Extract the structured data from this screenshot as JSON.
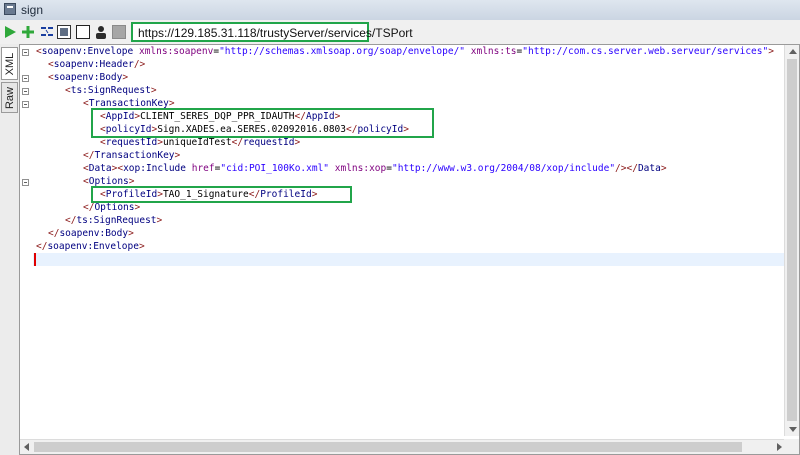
{
  "window": {
    "title": "sign"
  },
  "toolbar": {
    "icons": [
      "run-icon",
      "add-icon",
      "format-icon",
      "window-icon",
      "stop-icon",
      "user-icon",
      "disabled-icon"
    ],
    "url": "https://129.185.31.118/trustyServer/services/TSPort"
  },
  "tabs": {
    "xml_label": "XML",
    "raw_label": "Raw",
    "active": "XML"
  },
  "colors": {
    "highlight": "#21a54a",
    "tag": "#000080",
    "attr": "#7f007f",
    "value": "#2a00ff",
    "brackets": "#8b1a1a"
  },
  "code": {
    "l1": {
      "tag": "soapenv:Envelope",
      "a1": "xmlns:soapenv",
      "v1": "\"http://schemas.xmlsoap.org/soap/envelope/\"",
      "a2": "xmlns:ts",
      "v2": "\"http://com.cs.server.web.serveur/services\""
    },
    "l2": {
      "tag": "soapenv:Header"
    },
    "l3": {
      "tag": "soapenv:Body"
    },
    "l4": {
      "tag": "ts:SignRequest"
    },
    "l5": {
      "tag": "TransactionKey"
    },
    "l6": {
      "tag": "AppId",
      "text": "CLIENT_SERES_DQP_PPR_IDAUTH",
      "close": "AppId"
    },
    "l7": {
      "tag": "policyId",
      "text": "Sign.XADES.ea.SERES.02092016.0803",
      "close": "policyId"
    },
    "l8": {
      "tag": "requestId",
      "text": "uniqueIdTest",
      "close": "requestId"
    },
    "l9": {
      "close": "TransactionKey"
    },
    "l10": {
      "tag": "Data",
      "inner_tag": "xop:Include",
      "a1": "href",
      "v1": "\"cid:POI_100Ko.xml\"",
      "a2": "xmlns:xop",
      "v2": "\"http://www.w3.org/2004/08/xop/include\"",
      "close": "Data"
    },
    "l11": {
      "tag": "Options"
    },
    "l12": {
      "tag": "ProfileId",
      "text": "TAO_1_Signature",
      "close": "ProfileId"
    },
    "l13": {
      "close": "Options"
    },
    "l14": {
      "close": "ts:SignRequest"
    },
    "l15": {
      "close": "soapenv:Body"
    },
    "l16": {
      "close": "soapenv:Envelope"
    }
  }
}
